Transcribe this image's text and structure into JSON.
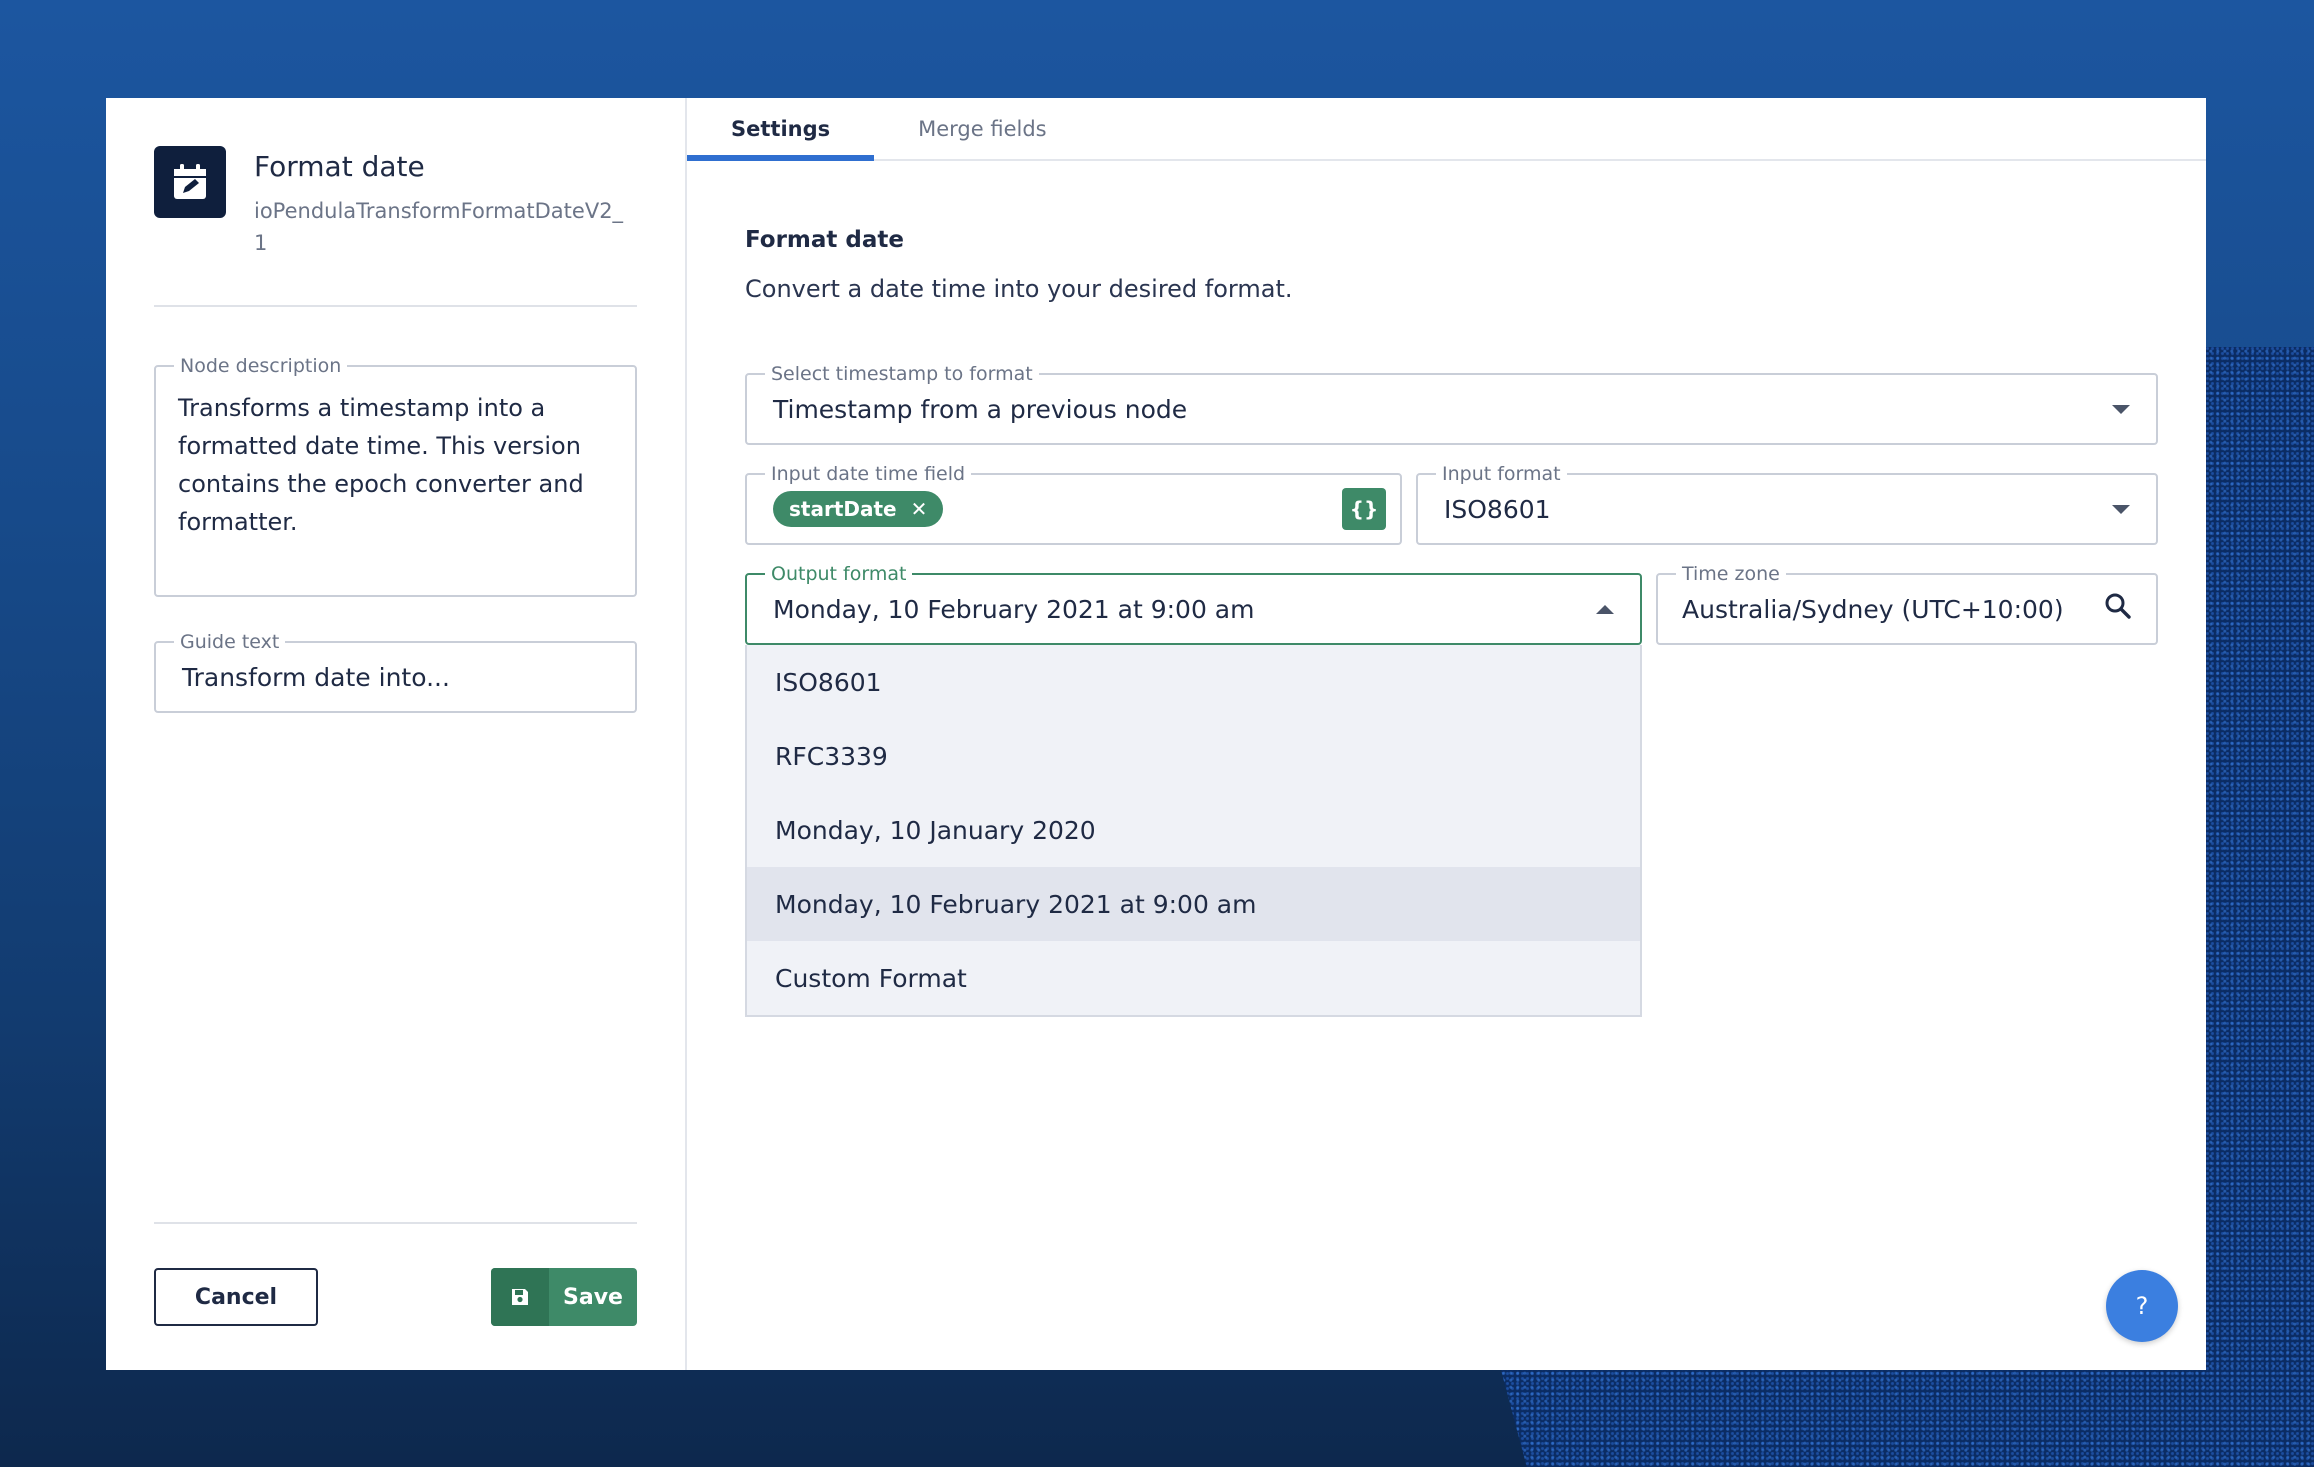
{
  "node": {
    "title": "Format date",
    "id": "ioPendulaTransformFormatDateV2_1",
    "icon": "calendar-edit-icon"
  },
  "left": {
    "description_label": "Node description",
    "description_value": "Transforms a timestamp into a formatted date time. This version contains the epoch converter and formatter.",
    "guide_label": "Guide text",
    "guide_value": "Transform date into..."
  },
  "footer": {
    "cancel_label": "Cancel",
    "save_label": "Save"
  },
  "tabs": [
    {
      "label": "Settings",
      "active": true
    },
    {
      "label": "Merge fields",
      "active": false
    }
  ],
  "settings": {
    "section_title": "Format date",
    "section_desc": "Convert a date time into your desired format.",
    "timestamp_select": {
      "label": "Select timestamp to format",
      "value": "Timestamp from a previous node"
    },
    "input_field": {
      "label": "Input date time field",
      "chip": "startDate"
    },
    "input_format": {
      "label": "Input format",
      "value": "ISO8601"
    },
    "output_format": {
      "label": "Output format",
      "value": "Monday, 10 February 2021 at 9:00 am",
      "options": [
        "ISO8601",
        "RFC3339",
        "Monday, 10 January 2020",
        "Monday, 10 February 2021 at 9:00 am",
        "Custom Format"
      ],
      "selected_index": 3
    },
    "time_zone": {
      "label": "Time zone",
      "value": "Australia/Sydney (UTC+10:00)"
    }
  },
  "help_label": "?",
  "colors": {
    "accent_green": "#3e8a68",
    "tab_active": "#2f6fd0",
    "help_blue": "#3b7fe0",
    "icon_dark": "#0f1f3d"
  }
}
